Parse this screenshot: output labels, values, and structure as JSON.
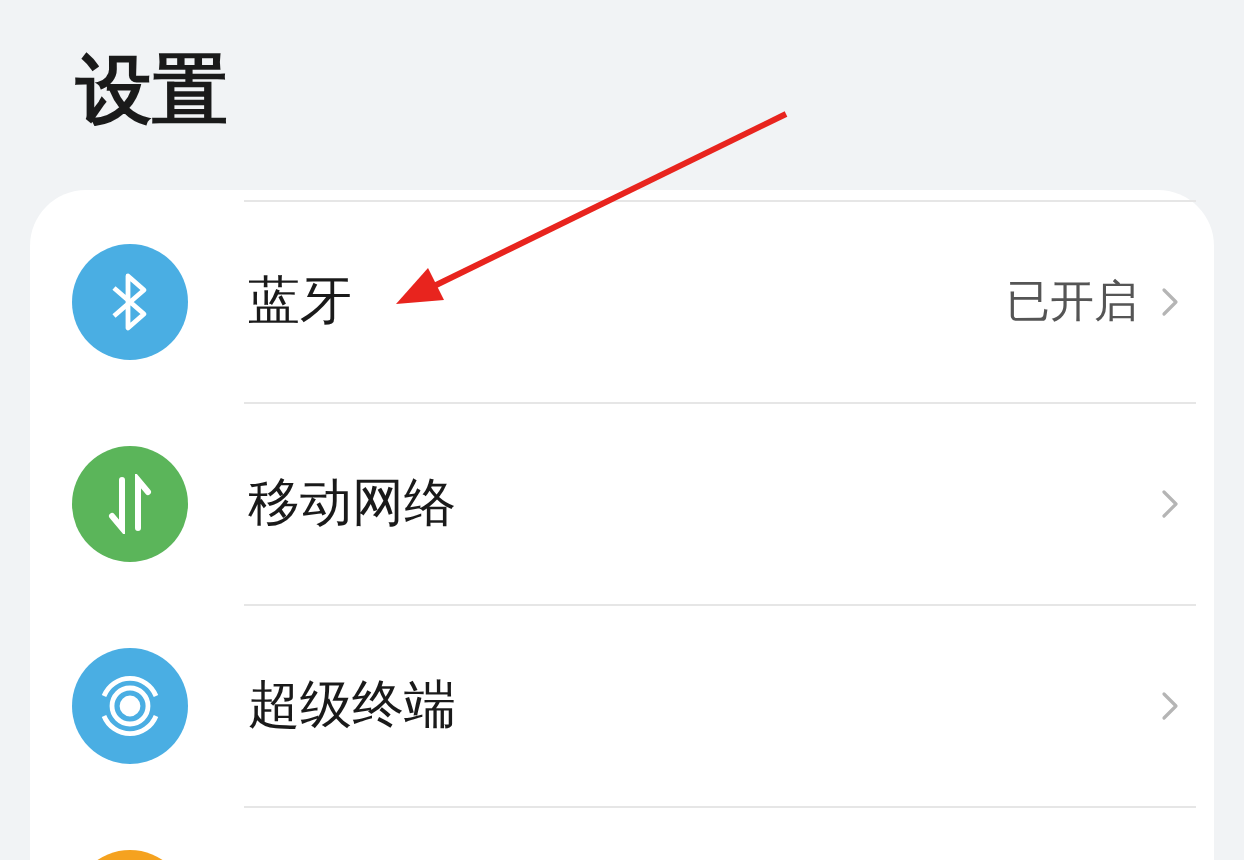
{
  "title": "设置",
  "items": [
    {
      "kind": "bluetooth",
      "color": "#4aaee3",
      "label": "蓝牙",
      "status": "已开启"
    },
    {
      "kind": "mobile-data",
      "color": "#5bb55a",
      "label": "移动网络"
    },
    {
      "kind": "super-device",
      "color": "#4aaee3",
      "label": "超级终端"
    },
    {
      "kind": "other",
      "color": "#f5a21f"
    }
  ]
}
